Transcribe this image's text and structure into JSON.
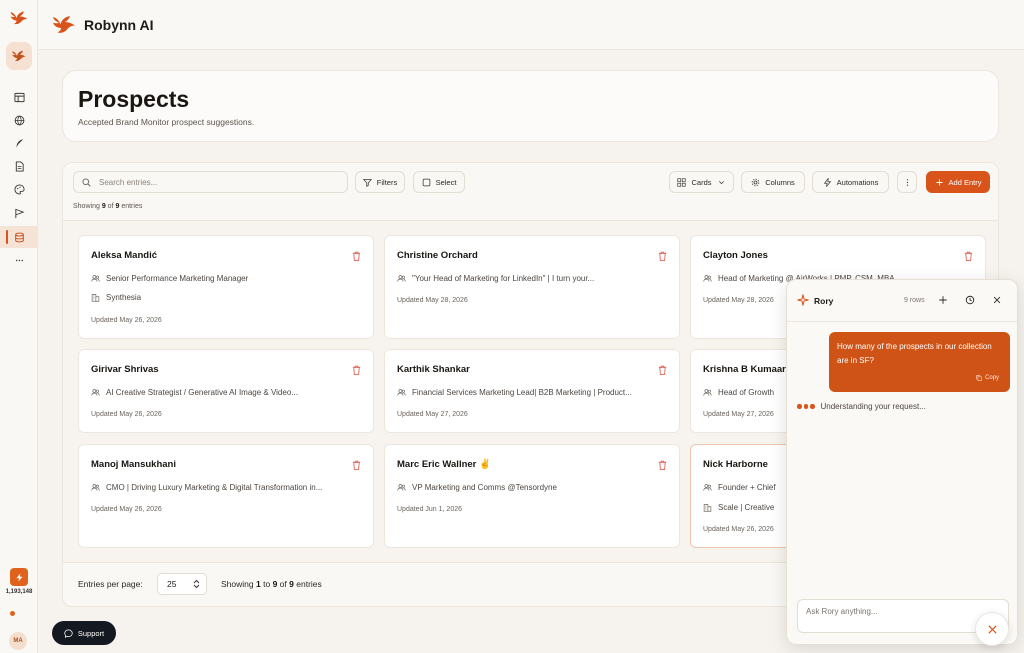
{
  "app": {
    "brand": "Robynn AI",
    "accent_color": "#d9541a",
    "credits": "1,193,148",
    "user_initials": "MA",
    "support_label": "Support"
  },
  "rail": {
    "icons": [
      "table-icon",
      "globe-icon",
      "feather-icon",
      "document-icon",
      "palette-icon",
      "flag-icon",
      "database-icon",
      "more-icon"
    ],
    "active": "database-icon"
  },
  "page": {
    "title": "Prospects",
    "subtitle": "Accepted Brand Monitor prospect suggestions."
  },
  "toolbar": {
    "search_placeholder": "Search entries...",
    "filters": "Filters",
    "select": "Select",
    "view": "Cards",
    "columns": "Columns",
    "automations": "Automations",
    "add_entry": "Add Entry",
    "showing_prefix": "Showing",
    "showing_count": "9",
    "showing_of": "of",
    "showing_total": "9",
    "showing_suffix": "entries"
  },
  "cards": [
    {
      "name": "Aleksa Mandić",
      "title": "Senior Performance Marketing Manager",
      "company": "Synthesia",
      "updated": "Updated May 26, 2026"
    },
    {
      "name": "Christine Orchard",
      "title": "\"Your Head of Marketing for LinkedIn\" | I turn your...",
      "company": "",
      "updated": "Updated May 28, 2026"
    },
    {
      "name": "Clayton Jones",
      "title": "Head of Marketing @ AirWorks | PMP, CSM, MBA",
      "company": "",
      "updated": "Updated May 28, 2026"
    },
    {
      "name": "Girivar Shrivas",
      "title": "AI Creative Strategist / Generative AI Image & Video...",
      "company": "",
      "updated": "Updated May 26, 2026"
    },
    {
      "name": "Karthik Shankar",
      "title": "Financial Services Marketing Lead| B2B Marketing | Product...",
      "company": "",
      "updated": "Updated May 27, 2026"
    },
    {
      "name": "Krishna B Kumaar",
      "title": "Head of Growth",
      "company": "",
      "updated": "Updated May 27, 2026"
    },
    {
      "name": "Manoj Mansukhani",
      "title": "CMO | Driving Luxury Marketing & Digital Transformation in...",
      "company": "",
      "updated": "Updated May 26, 2026"
    },
    {
      "name": "Marc Eric Wallner ✌️",
      "title": "VP Marketing and Comms @Tensordyne",
      "company": "",
      "updated": "Updated Jun 1, 2026"
    },
    {
      "name": "Nick Harborne",
      "title": "Founder + Chief",
      "company": "Scale | Creative",
      "updated": "Updated May 26, 2026"
    }
  ],
  "pagination": {
    "entries_per_page_label": "Entries per page:",
    "per_page": "25",
    "range_prefix": "Showing",
    "range_start": "1",
    "range_to": "to",
    "range_end": "9",
    "range_of": "of",
    "range_total": "9",
    "range_suffix": "entries"
  },
  "chat": {
    "title": "Rory",
    "rows": "9 rows",
    "user_message": "How many of the prospects in our collection are in SF?",
    "copy_label": "Copy",
    "status": "Understanding your request...",
    "input_placeholder": "Ask Rory anything..."
  }
}
